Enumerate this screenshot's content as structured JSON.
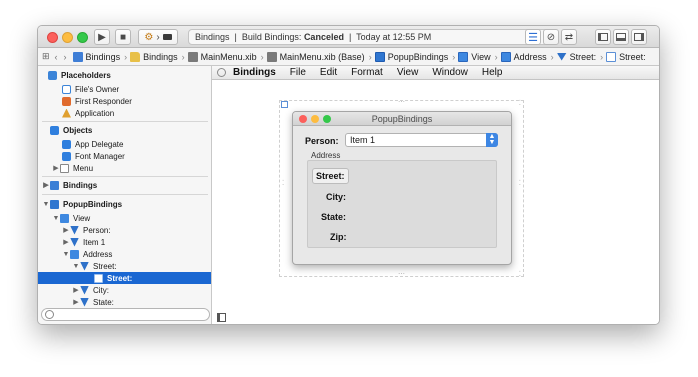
{
  "toolbar": {
    "status_scheme": "Bindings",
    "status_action": "Build Bindings:",
    "status_result": "Canceled",
    "status_time": "Today at 12:55 PM"
  },
  "jumpbar": {
    "items": [
      "Bindings",
      "Bindings",
      "MainMenu.xib",
      "MainMenu.xib (Base)",
      "PopupBindings",
      "View",
      "Address",
      "Street:",
      "Street:"
    ]
  },
  "sidebar": {
    "placeholders_header": "Placeholders",
    "placeholders": [
      "File's Owner",
      "First Responder",
      "Application"
    ],
    "objects_header": "Objects",
    "objects": [
      "App Delegate",
      "Font Manager",
      "Menu"
    ],
    "bindings_item": "Bindings",
    "popup_window": "PopupBindings",
    "tree": {
      "view": "View",
      "person": "Person:",
      "item1": "Item 1",
      "address": "Address",
      "street_outlet": "Street:",
      "street_field": "Street:",
      "city": "City:",
      "state": "State:"
    }
  },
  "menubar": {
    "items": [
      "Bindings",
      "File",
      "Edit",
      "Format",
      "View",
      "Window",
      "Help"
    ]
  },
  "document_window": {
    "title": "PopupBindings",
    "person_label": "Person:",
    "popup_value": "Item 1",
    "address_label": "Address",
    "fields": [
      "Street:",
      "City:",
      "State:",
      "Zip:"
    ]
  }
}
